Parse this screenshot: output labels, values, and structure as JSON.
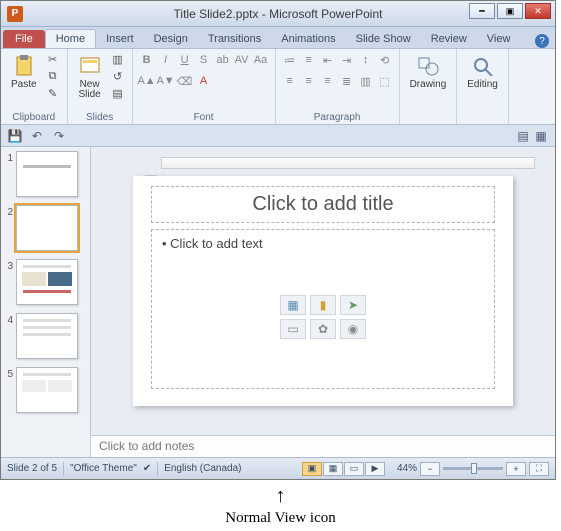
{
  "window": {
    "app_letter": "P",
    "title": "Title Slide2.pptx - Microsoft PowerPoint"
  },
  "tabs": {
    "file": "File",
    "home": "Home",
    "insert": "Insert",
    "design": "Design",
    "transitions": "Transitions",
    "animations": "Animations",
    "slideshow": "Slide Show",
    "review": "Review",
    "view": "View"
  },
  "ribbon": {
    "clipboard": {
      "label": "Clipboard",
      "paste": "Paste"
    },
    "slides": {
      "label": "Slides",
      "new_slide": "New\nSlide"
    },
    "font": {
      "label": "Font"
    },
    "paragraph": {
      "label": "Paragraph"
    },
    "drawing": {
      "label": "Drawing",
      "btn": "Drawing"
    },
    "editing": {
      "label": "Editing",
      "btn": "Editing"
    }
  },
  "thumbs": {
    "count": 5,
    "selected": 2
  },
  "slide": {
    "title_placeholder": "Click to add title",
    "body_placeholder": "Click to add text"
  },
  "notes": {
    "placeholder": "Click to add notes"
  },
  "status": {
    "slide_info": "Slide 2 of 5",
    "theme": "\"Office Theme\"",
    "language": "English (Canada)",
    "zoom": "44%"
  },
  "annotation": {
    "label": "Normal View icon"
  }
}
